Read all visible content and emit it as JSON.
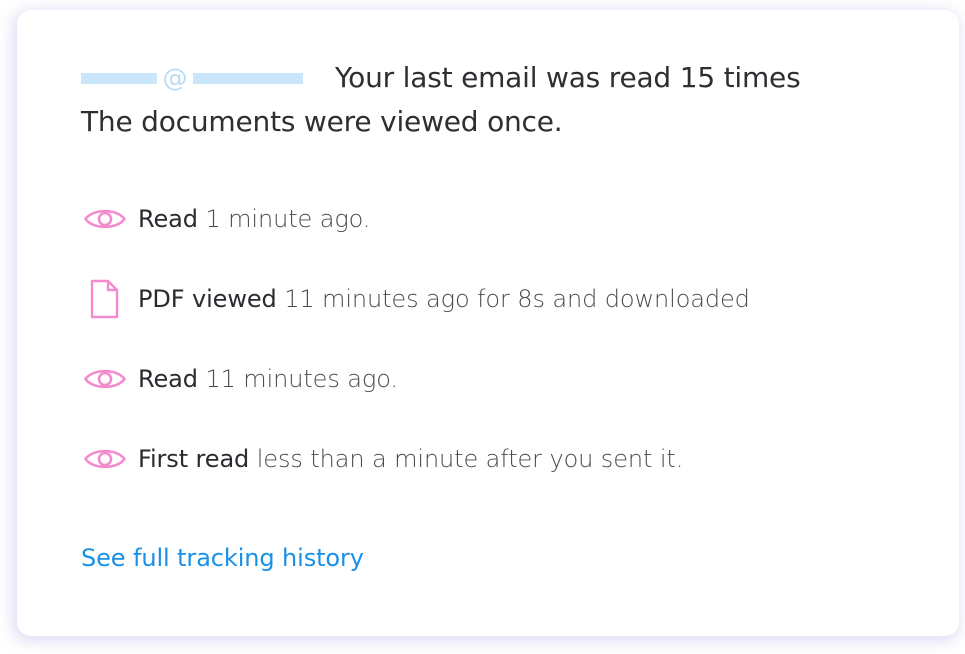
{
  "header": {
    "at_symbol": "@",
    "headline": "Your last email was read 15 times",
    "subheadline": "The documents were viewed once."
  },
  "events": [
    {
      "icon": "eye-icon",
      "verb": "Read",
      "detail": "1 minute ago."
    },
    {
      "icon": "document-icon",
      "verb": "PDF viewed",
      "detail": "11 minutes ago for 8s and downloaded"
    },
    {
      "icon": "eye-icon",
      "verb": "Read",
      "detail": "11 minutes ago."
    },
    {
      "icon": "eye-icon",
      "verb": "First read",
      "detail": "less than a minute after you sent it."
    }
  ],
  "footer": {
    "history_link": "See full tracking history"
  },
  "colors": {
    "icon_pink": "#f48bcf",
    "link_blue": "#1890e8",
    "placeholder_blue": "#c9e6fb",
    "text_dark": "#2e2e33"
  }
}
